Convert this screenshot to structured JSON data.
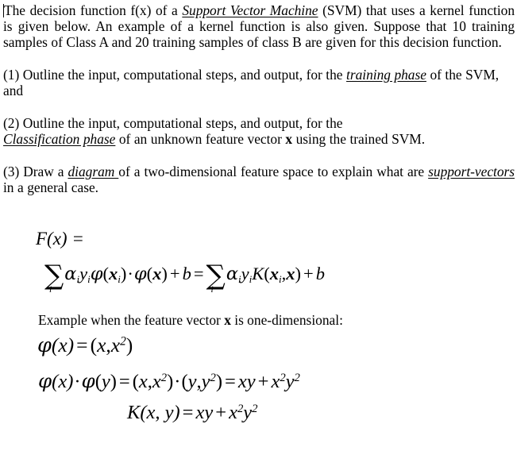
{
  "document": {
    "title": "SVM decision function question sheet",
    "cursor_visible": true,
    "background_color": "#ffffff",
    "text_color": "#000000"
  },
  "paragraphs": {
    "p1": {
      "run1": "The decision function f(x) of a ",
      "emph1": "Support Vector Machine",
      "run2": " (SVM) that uses a kernel function is given below. An example of a kernel function is also given.  Suppose that 10 training samples of Class A and 20 training samples of class B are given for this decision function."
    },
    "p2": {
      "run1": "(1) Outline the input, computational steps, and output, for the ",
      "emph1": "training phase",
      "run2": " of the SVM, and"
    },
    "p3": {
      "run1": "(2) Outline the input, computational steps, and output, for the ",
      "emph1": "Classification phase",
      "run2": " of an unknown feature vector ",
      "bold1": "x",
      "run3": " using the trained SVM."
    },
    "p4": {
      "run1": "(3) Draw a ",
      "emph1": "diagram ",
      "run2": "of a two-dimensional feature space to explain what are ",
      "emph2": "support-vectors",
      "run3": " in a general case."
    }
  },
  "equations": {
    "fx_label": "F(x) =",
    "summation": {
      "sigma": "∑",
      "index": "i",
      "alpha": "α",
      "y": "y",
      "phi": "φ",
      "lparen": "(",
      "rparen": ")",
      "bold_x": "x",
      "dot": "·",
      "plus": "+",
      "b": "b",
      "equals": "=",
      "K": "K",
      "comma": ",",
      "full_text": "∑ᵢ αᵢ yᵢ φ(xᵢ) · φ(x) + b = ∑ᵢ αᵢ yᵢ K(xᵢ, x) + b"
    },
    "example_caption": {
      "run1": "Example when the feature vector ",
      "bold1": "x",
      "run2": " is one-dimensional:"
    },
    "phi_def": {
      "full_text": "φ(x) = (x, x²)",
      "phi": "φ",
      "lhs": "(x)",
      "equals": "=",
      "rhs_open": "(",
      "rhs_x": "x",
      "rhs_comma": ",",
      "rhs_x2": "x",
      "exp2": "2",
      "rhs_close": ")"
    },
    "phi_dot": {
      "full_text": "φ(x) · φ(y) = (x, x²) · (y, y²) = xy + x²y²"
    },
    "kernel": {
      "full_text": "K(x, y) = xy + x²y²",
      "K": "K",
      "args": "(x, y)",
      "equals": "=",
      "xy": "xy",
      "plus": "+",
      "x2y2": "x²y²"
    }
  }
}
